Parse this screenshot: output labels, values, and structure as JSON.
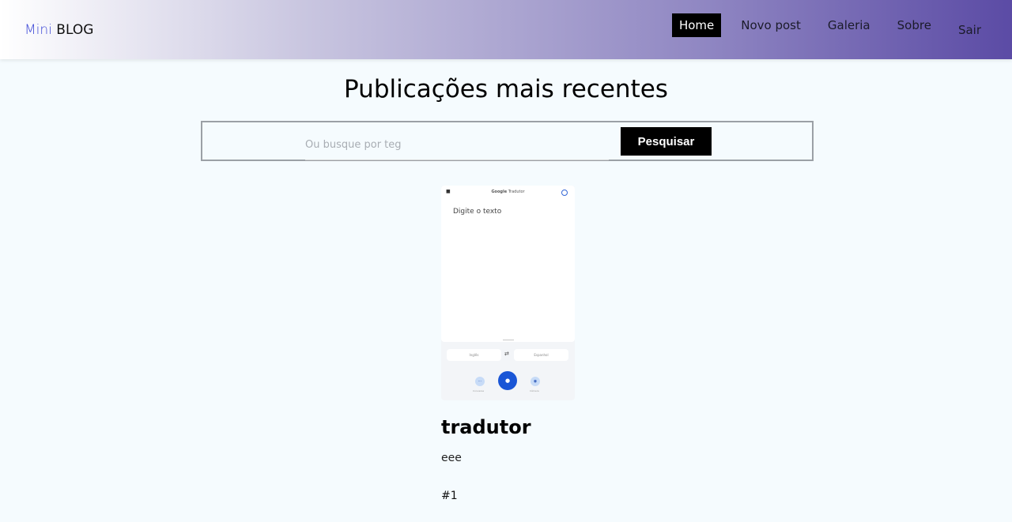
{
  "navbar": {
    "brand_part1": "Mini",
    "brand_part2": "BLOG",
    "links": [
      {
        "label": "Home",
        "active": true
      },
      {
        "label": "Novo post",
        "active": false
      },
      {
        "label": "Galeria",
        "active": false
      },
      {
        "label": "Sobre",
        "active": false
      },
      {
        "label": "Sair",
        "active": false
      }
    ]
  },
  "page": {
    "title": "Publicações mais recentes"
  },
  "search": {
    "placeholder": "Ou busque por teg",
    "value": "",
    "button_label": "Pesquisar"
  },
  "post": {
    "image": {
      "app_logo_google": "Google",
      "app_logo_product": "Tradutor",
      "prompt": "Digite o texto",
      "source_lang": "Inglês",
      "target_lang": "Espanhol",
      "left_action_caption": "Conversa",
      "right_action_caption": "Câmera",
      "icons": [
        "menu-icon",
        "account-icon",
        "swap-icon",
        "conversation-icon",
        "mic-icon",
        "camera-icon"
      ]
    },
    "title": "tradutor",
    "body": "eee",
    "tag": "#1"
  },
  "colors": {
    "brand_accent": "#3c47d6",
    "active_nav_bg": "#000000",
    "gradient_end": "#5b4ba5",
    "page_bg": "#f5fbfe",
    "search_button_bg": "#000000"
  }
}
